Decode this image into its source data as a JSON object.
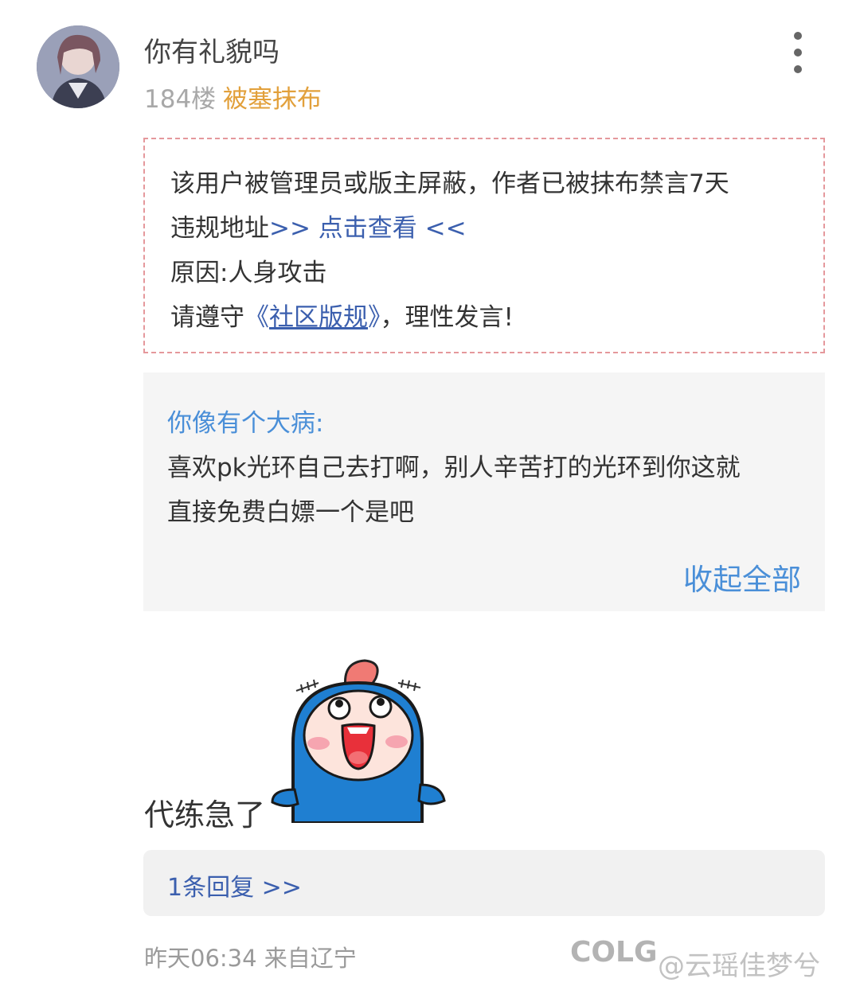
{
  "post": {
    "username": "你有礼貌吗",
    "floor": "184楼",
    "badge": "被塞抹布"
  },
  "notice": {
    "line1": "该用户被管理员或版主屏蔽，作者已被抹布禁言7天",
    "line2_prefix": "违规地址",
    "line2_link": ">> 点击查看 <<",
    "line3": "原因:人身攻击",
    "line4_prefix": "请遵守",
    "line4_open": "《",
    "line4_link": "社区版规",
    "line4_close": "》",
    "line4_suffix": "，理性发言!"
  },
  "quote": {
    "author": "你像有个大病:",
    "line1": "喜欢pk光环自己去打啊，别人辛苦打的光环到你这就",
    "line2": "直接免费白嫖一个是吧",
    "collapse_label": "收起全部"
  },
  "content": {
    "text": "代练急了",
    "sticker_icon": "blue-fish-laughing-sticker"
  },
  "replies": {
    "label": "1条回复 >>"
  },
  "footer": {
    "timestamp": "昨天06:34 来自辽宁",
    "watermark": "COLG",
    "watermark_user": "@云瑶佳梦兮"
  },
  "colors": {
    "accent_blue": "#4a8fd8",
    "link_blue": "#3b5fae",
    "badge_orange": "#e2a03b",
    "notice_border": "#e5989c"
  }
}
